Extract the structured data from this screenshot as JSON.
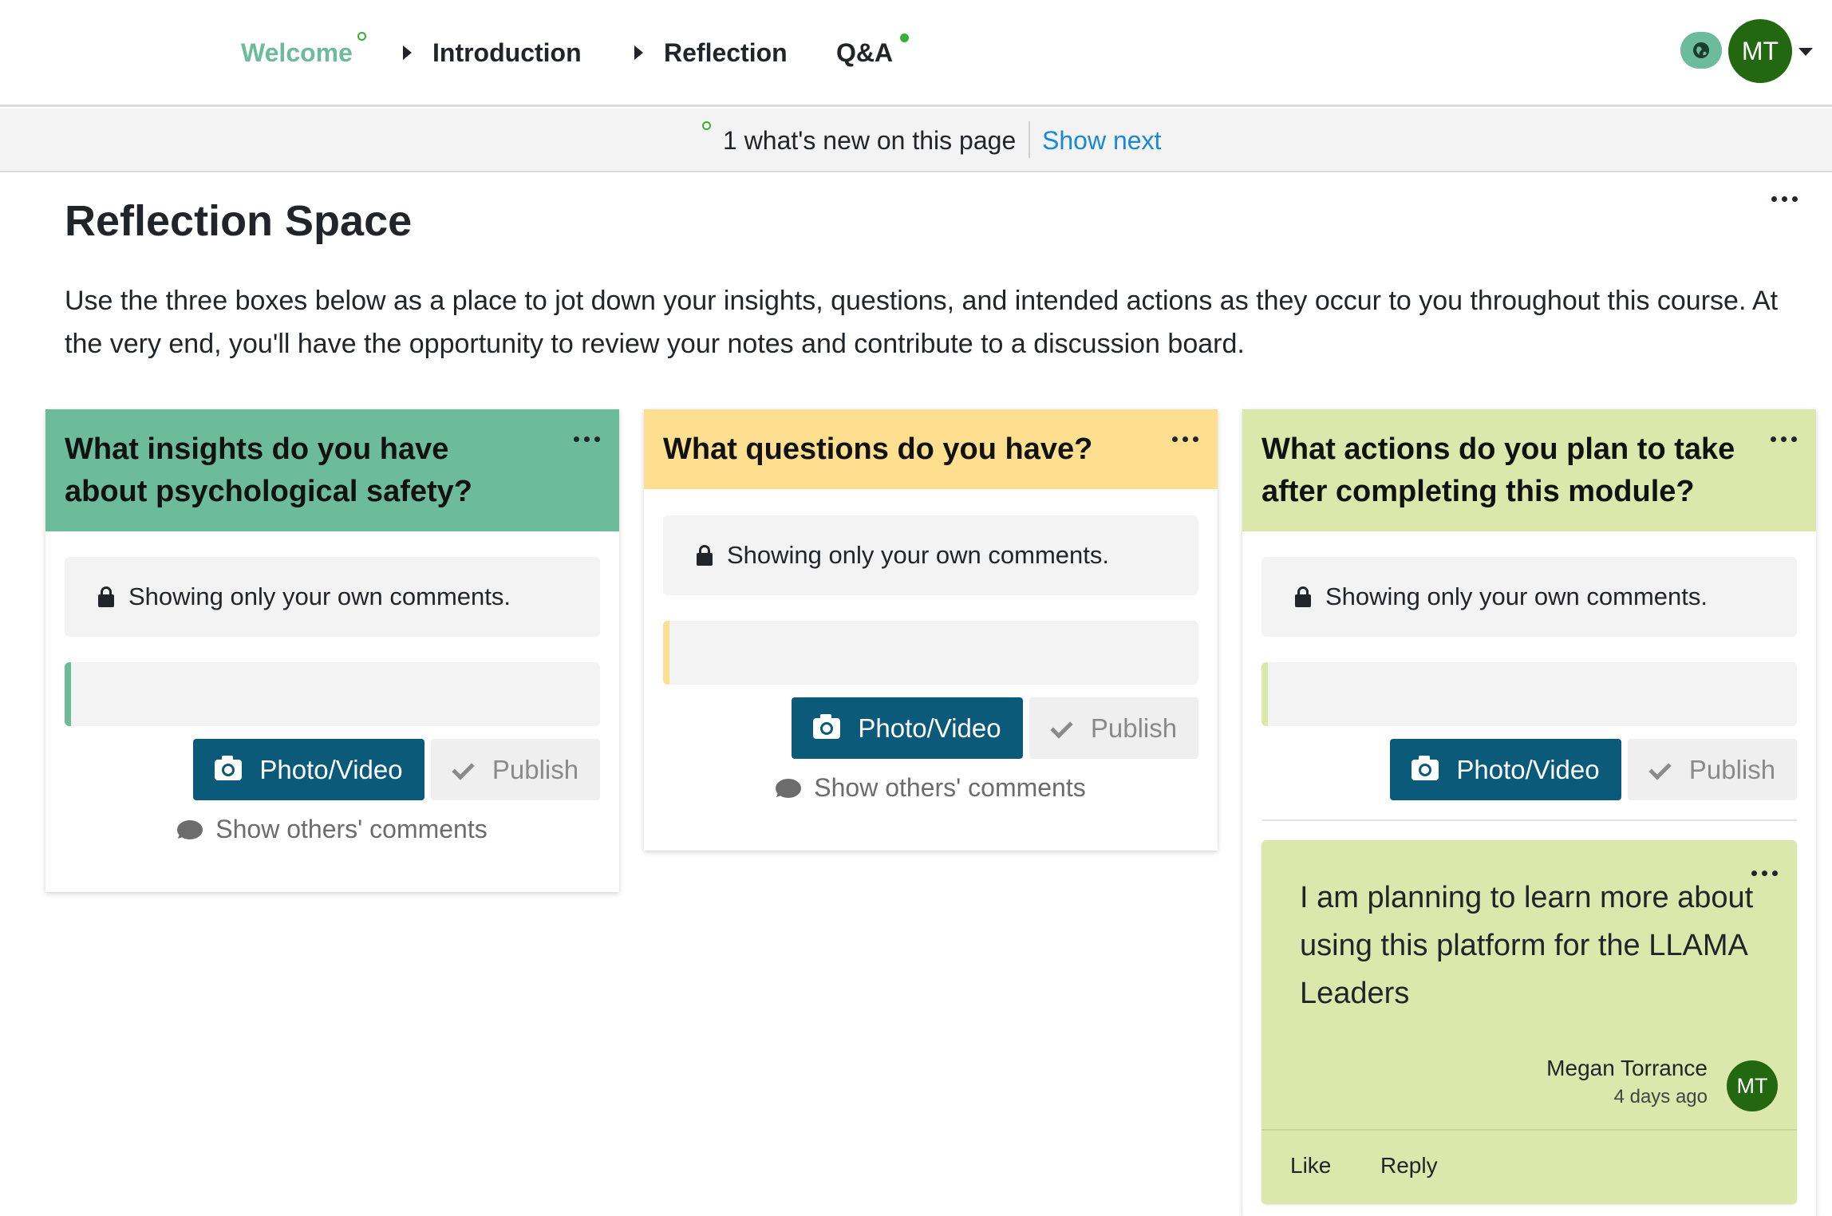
{
  "nav": {
    "items": [
      {
        "label": "Welcome",
        "state": "active"
      },
      {
        "label": "Introduction"
      },
      {
        "label": "Reflection"
      },
      {
        "label": "Q&A"
      }
    ],
    "user_initials": "MT",
    "accent_color": "#6cbb9b",
    "new_dot_color": "#34b233"
  },
  "whats_new": {
    "text": "1 what's new on this page",
    "action": "Show next"
  },
  "page": {
    "title": "Reflection Space",
    "description": "Use the three boxes below as a place to jot down your insights, questions, and intended actions as they occur to you throughout this course. At the very end, you'll have the opportunity to review your notes and contribute to a discussion board."
  },
  "columns": [
    {
      "title": "What insights do you have about psychological safety?",
      "color": "#6cbb9b",
      "privacy_note": "Showing only your own comments.",
      "photo_label": "Photo/Video",
      "publish_label": "Publish",
      "others_label": "Show others' comments"
    },
    {
      "title": "What questions do you have?",
      "color": "#fedf8f",
      "privacy_note": "Showing only your own comments.",
      "photo_label": "Photo/Video",
      "publish_label": "Publish",
      "others_label": "Show others' comments"
    },
    {
      "title": "What actions do you plan to take after completing this module?",
      "color": "#dce7ab",
      "privacy_note": "Showing only your own comments.",
      "photo_label": "Photo/Video",
      "publish_label": "Publish",
      "post": {
        "text": "I am planning to learn more about using this platform for the LLAMA Leaders",
        "author": "Megan Torrance",
        "author_initials": "MT",
        "time": "4 days ago",
        "like_label": "Like",
        "reply_label": "Reply"
      }
    }
  ],
  "icons": {
    "lock": "lock-icon",
    "camera": "camera-icon",
    "check": "check-icon",
    "comment": "comment-bubble-icon",
    "globe": "globe-icon",
    "more": "more-dots-icon",
    "caret": "caret-right-icon"
  },
  "colors": {
    "primary_button": "#0b5a7a",
    "link": "#1a88d8",
    "avatar": "#236710"
  }
}
